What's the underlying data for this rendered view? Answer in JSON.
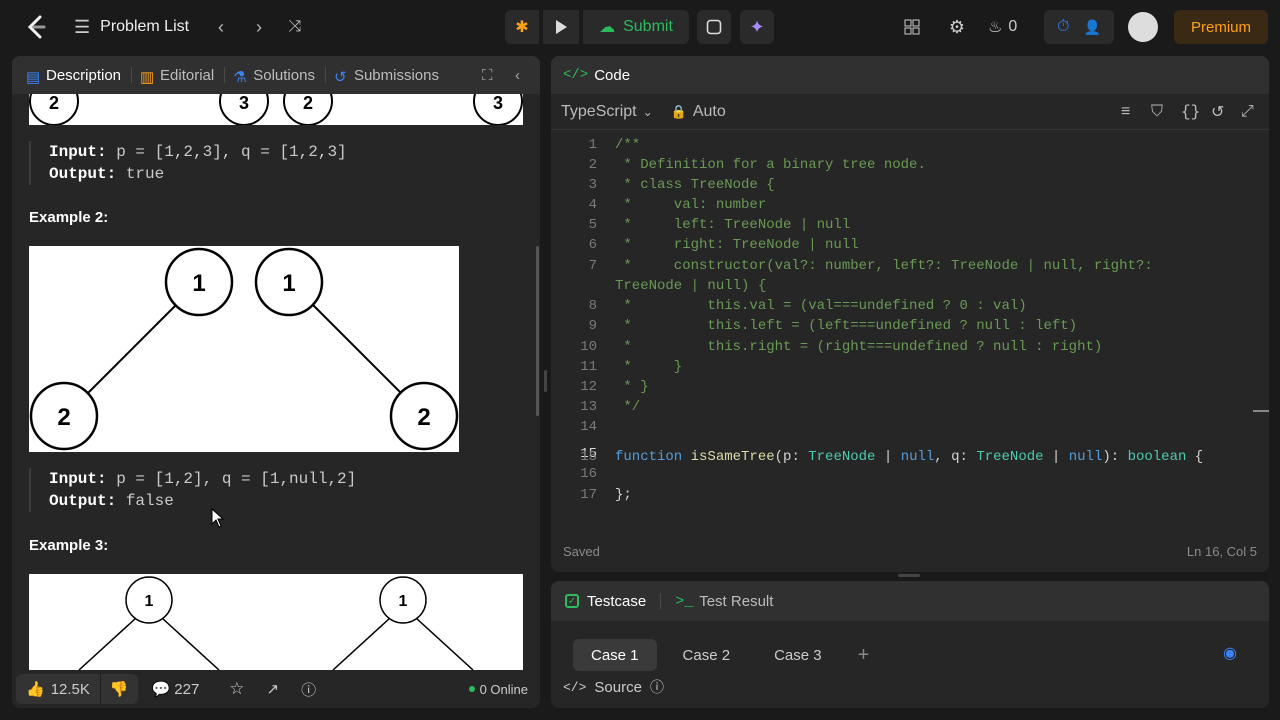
{
  "header": {
    "problem_list": "Problem List",
    "submit": "Submit",
    "streak_count": "0",
    "premium": "Premium"
  },
  "left_tabs": [
    {
      "label": "Description"
    },
    {
      "label": "Editorial"
    },
    {
      "label": "Solutions"
    },
    {
      "label": "Submissions"
    }
  ],
  "examples": {
    "ex1": {
      "input_label": "Input:",
      "input_value": " p = [1,2,3], q = [1,2,3]",
      "output_label": "Output:",
      "output_value": " true"
    },
    "ex2": {
      "title": "Example 2:",
      "input_label": "Input:",
      "input_value": " p = [1,2], q = [1,null,2]",
      "output_label": "Output:",
      "output_value": " false"
    },
    "ex3": {
      "title": "Example 3:"
    }
  },
  "tree_nodes": {
    "ex1_top": [
      "2",
      "3",
      "2",
      "3"
    ],
    "ex2": [
      "1",
      "1",
      "2",
      "2"
    ],
    "ex3": [
      "1",
      "1"
    ]
  },
  "left_footer": {
    "likes": "12.5K",
    "comments": "227",
    "online": "0 Online"
  },
  "code_panel": {
    "title": "Code",
    "language": "TypeScript",
    "mode": "Auto",
    "status": "Saved",
    "cursor": "Ln 16, Col 5"
  },
  "code_lines": [
    {
      "n": "1",
      "text": "/**"
    },
    {
      "n": "2",
      "text": " * Definition for a binary tree node."
    },
    {
      "n": "3",
      "text": " * class TreeNode {"
    },
    {
      "n": "4",
      "text": " *     val: number"
    },
    {
      "n": "5",
      "text": " *     left: TreeNode | null"
    },
    {
      "n": "6",
      "text": " *     right: TreeNode | null"
    },
    {
      "n": "7",
      "text": " *     constructor(val?: number, left?: TreeNode | null, right?:"
    },
    {
      "n": "",
      "text": "TreeNode | null) {"
    },
    {
      "n": "8",
      "text": " *         this.val = (val===undefined ? 0 : val)"
    },
    {
      "n": "9",
      "text": " *         this.left = (left===undefined ? null : left)"
    },
    {
      "n": "10",
      "text": " *         this.right = (right===undefined ? null : right)"
    },
    {
      "n": "11",
      "text": " *     }"
    },
    {
      "n": "12",
      "text": " * }"
    },
    {
      "n": "13",
      "text": " */"
    },
    {
      "n": "14",
      "text": ""
    },
    {
      "n": "15",
      "text": ""
    },
    {
      "n": "16",
      "text": ""
    },
    {
      "n": "17",
      "text": "};"
    }
  ],
  "code_fn": {
    "kw": "function",
    "name": "isSameTree",
    "p": "(p: ",
    "t1": "TreeNode",
    "bar1": " | ",
    "null1": "null",
    "q": ", q: ",
    "t2": "TreeNode",
    "bar2": " | ",
    "null2": "null",
    "ret": "): ",
    "bool": "boolean",
    "brace": " {"
  },
  "bottom_panel": {
    "tab_testcase": "Testcase",
    "tab_result": "Test Result",
    "cases": [
      "Case 1",
      "Case 2",
      "Case 3"
    ],
    "source": "Source"
  }
}
